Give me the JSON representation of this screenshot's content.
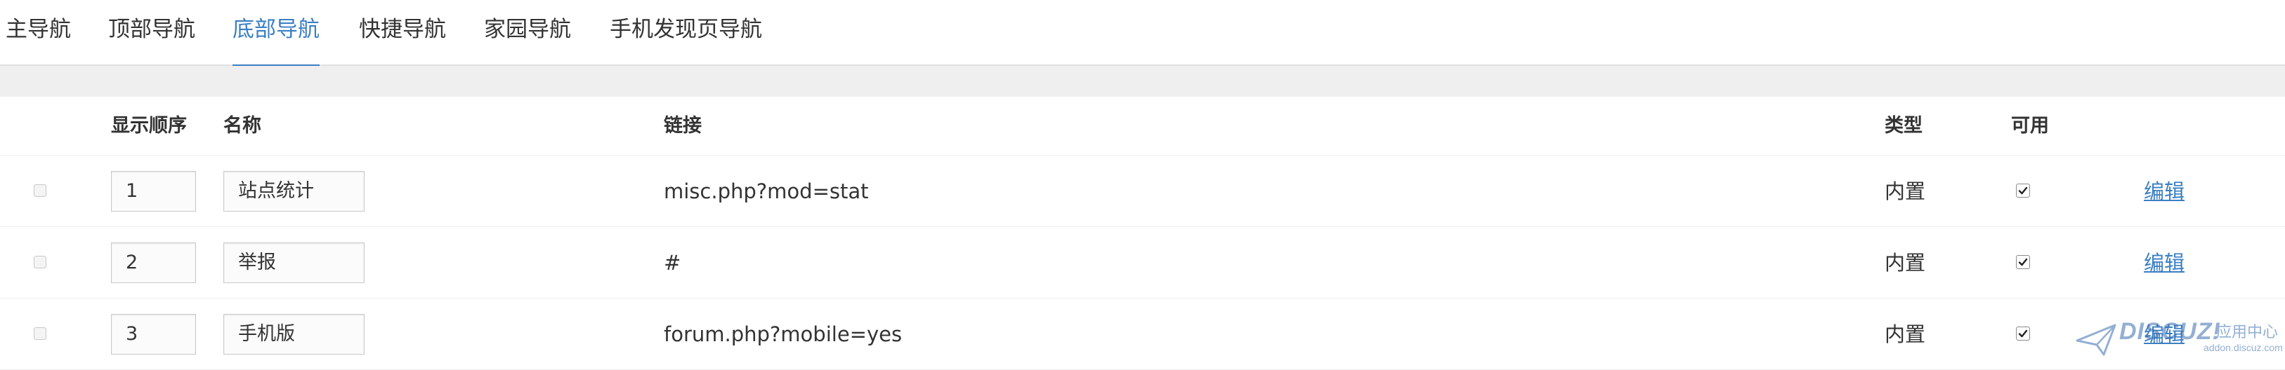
{
  "tabs": [
    {
      "label": "主导航",
      "active": false
    },
    {
      "label": "顶部导航",
      "active": false
    },
    {
      "label": "底部导航",
      "active": true
    },
    {
      "label": "快捷导航",
      "active": false
    },
    {
      "label": "家园导航",
      "active": false
    },
    {
      "label": "手机发现页导航",
      "active": false
    }
  ],
  "table": {
    "headers": {
      "order": "显示顺序",
      "name": "名称",
      "link": "链接",
      "type": "类型",
      "enabled": "可用"
    },
    "rows": [
      {
        "selected": false,
        "order": "1",
        "name": "站点统计",
        "link": "misc.php?mod=stat",
        "type": "内置",
        "enabled": true,
        "edit_label": "编辑"
      },
      {
        "selected": false,
        "order": "2",
        "name": "举报",
        "link": "#",
        "type": "内置",
        "enabled": true,
        "edit_label": "编辑"
      },
      {
        "selected": false,
        "order": "3",
        "name": "手机版",
        "link": "forum.php?mobile=yes",
        "type": "内置",
        "enabled": true,
        "edit_label": "编辑"
      }
    ]
  },
  "watermark": {
    "logo_text": "DISCUZ!",
    "cn_text": "应用中心",
    "url_text": "addon.discuz.com"
  },
  "colors": {
    "accent": "#3b7fc4",
    "band": "#efefef",
    "text": "#333333"
  }
}
